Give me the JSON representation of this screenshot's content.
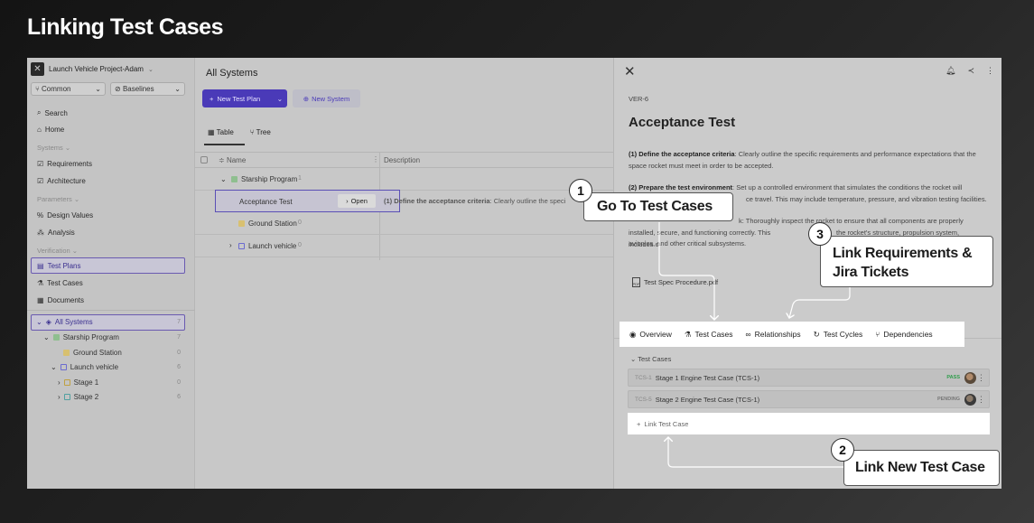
{
  "page_title": "Linking Test Cases",
  "sidebar": {
    "project": "Launch Vehicle Project-Adam",
    "selectors": [
      "Common",
      "Baselines"
    ],
    "items": [
      {
        "label": "Search",
        "icon": "search-icon"
      },
      {
        "label": "Home",
        "icon": "home-icon"
      },
      {
        "label": "Systems",
        "section": true
      },
      {
        "label": "Requirements",
        "icon": "checkbox-icon"
      },
      {
        "label": "Architecture",
        "icon": "checkbox-icon"
      },
      {
        "label": "Parameters",
        "section": true
      },
      {
        "label": "Design Values",
        "icon": "percent-icon"
      },
      {
        "label": "Analysis",
        "icon": "analysis-icon"
      },
      {
        "label": "Verification",
        "section": true
      },
      {
        "label": "Test Plans",
        "icon": "clipboard-icon"
      },
      {
        "label": "Test Cases",
        "icon": "flask-icon"
      },
      {
        "label": "Documents",
        "icon": "document-icon"
      }
    ],
    "tree": [
      {
        "label": "All Systems",
        "count": "7"
      },
      {
        "label": "Starship Program",
        "count": "7"
      },
      {
        "label": "Ground Station",
        "count": "0"
      },
      {
        "label": "Launch vehicle",
        "count": "6"
      },
      {
        "label": "Stage 1",
        "count": "0"
      },
      {
        "label": "Stage 2",
        "count": "6"
      }
    ]
  },
  "middle": {
    "title": "All Systems",
    "new_plan": "New Test Plan",
    "new_system": "New System",
    "tabs": [
      "Table",
      "Tree"
    ],
    "columns": [
      "Name",
      "Description"
    ],
    "rows": [
      {
        "name": "Starship Program",
        "count": "1"
      },
      {
        "name": "Acceptance Test",
        "open": "Open",
        "desc_bold": "(1) Define the acceptance criteria",
        "desc": ": Clearly outline the speci"
      },
      {
        "name": "Ground Station",
        "count": "0"
      },
      {
        "name": "Launch vehicle",
        "count": "0"
      }
    ]
  },
  "panel": {
    "ver_id": "VER-6",
    "title": "Acceptance Test",
    "p1_bold": "(1) Define the acceptance criteria",
    "p1": ": Clearly outline the specific requirements and performance expectations that the space rocket must meet in order to be accepted.",
    "p2_bold": "(2) Prepare the test environment",
    "p2": ": Set up a controlled environment that simulates the conditions the rocket will",
    "p2b": "ce travel. This may include temperature, pressure, and vibration testing facilities.",
    "p3a": "k: Thoroughly inspect the rocket to ensure that all components are properly",
    "p3b": "installed, secure, and functioning correctly. This includes c",
    "p3c": "the rocket's structure, propulsion system,",
    "p3d": "avionics, and other critical subsystems.",
    "attachment": "Test Spec Procedure.pdf",
    "tabs": [
      "Overview",
      "Test Cases",
      "Relationships",
      "Test Cycles",
      "Dependencies"
    ],
    "section_label": "Test Cases",
    "test_cases": [
      {
        "id": "TCS-1",
        "name": "Stage 1 Engine Test Case (TCS-1)",
        "status": "PASS",
        "status_color": "#2e9d4a"
      },
      {
        "id": "TCS-5",
        "name": "Stage 2 Engine Test Case (TCS-1)",
        "status": "PENDING",
        "status_color": "#777777"
      }
    ],
    "link_label": "Link Test Case"
  },
  "callouts": [
    {
      "num": "1",
      "text": "Go To Test Cases"
    },
    {
      "num": "2",
      "text": "Link New Test Case"
    },
    {
      "num": "3",
      "line1": "Link Requirements &",
      "line2": "Jira Tickets"
    }
  ]
}
